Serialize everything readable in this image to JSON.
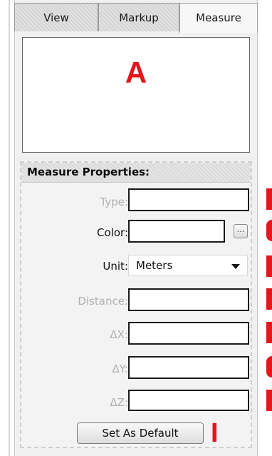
{
  "tabs": {
    "view": "View",
    "markup": "Markup",
    "measure": "Measure"
  },
  "preview": {
    "callout": "A"
  },
  "properties": {
    "title": "Measure Properties:",
    "type_label": "Type:",
    "color_label": "Color:",
    "color_button": "...",
    "unit_label": "Unit:",
    "unit_value": "Meters",
    "distance_label": "Distance:",
    "dx_label": "ΔX:",
    "dy_label": "ΔY:",
    "dz_label": "ΔZ:",
    "default_button": "Set As Default"
  },
  "callouts": {
    "set_default": "I"
  },
  "colors": {
    "callout_red": "#e8131b",
    "panel_bg": "#f0f0f0"
  }
}
